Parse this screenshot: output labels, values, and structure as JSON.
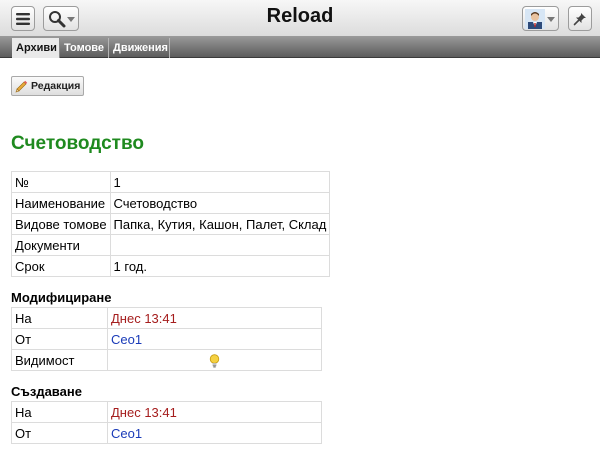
{
  "app": {
    "title": "Reload"
  },
  "tabs": [
    {
      "label": "Архиви",
      "active": true
    },
    {
      "label": "Томове",
      "active": false
    },
    {
      "label": "Движения",
      "active": false
    }
  ],
  "toolbar": {
    "edit_label": "Редакция"
  },
  "record": {
    "title": "Счетоводство",
    "fields": [
      {
        "key": "№",
        "value": "1"
      },
      {
        "key": "Наименование",
        "value": "Счетоводство"
      },
      {
        "key": "Видове томове",
        "value": "Папка, Кутия, Кашон, Палет, Склад"
      },
      {
        "key": "Документи",
        "value": ""
      },
      {
        "key": "Срок",
        "value": "1 год."
      }
    ]
  },
  "modified": {
    "title": "Модифициране",
    "on_label": "На",
    "on_value": "Днес 13:41",
    "by_label": "От",
    "by_value": "Ceo1",
    "visibility_label": "Видимост"
  },
  "created": {
    "title": "Създаване",
    "on_label": "На",
    "on_value": "Днес 13:41",
    "by_label": "От",
    "by_value": "Ceo1"
  },
  "colors": {
    "title": "#1f8a1f",
    "date": "#a51d1d",
    "user": "#1a3bb8"
  },
  "icons": [
    "menu-icon",
    "search-icon",
    "user-avatar-icon",
    "pin-icon",
    "pencil-icon",
    "lightbulb-icon"
  ]
}
